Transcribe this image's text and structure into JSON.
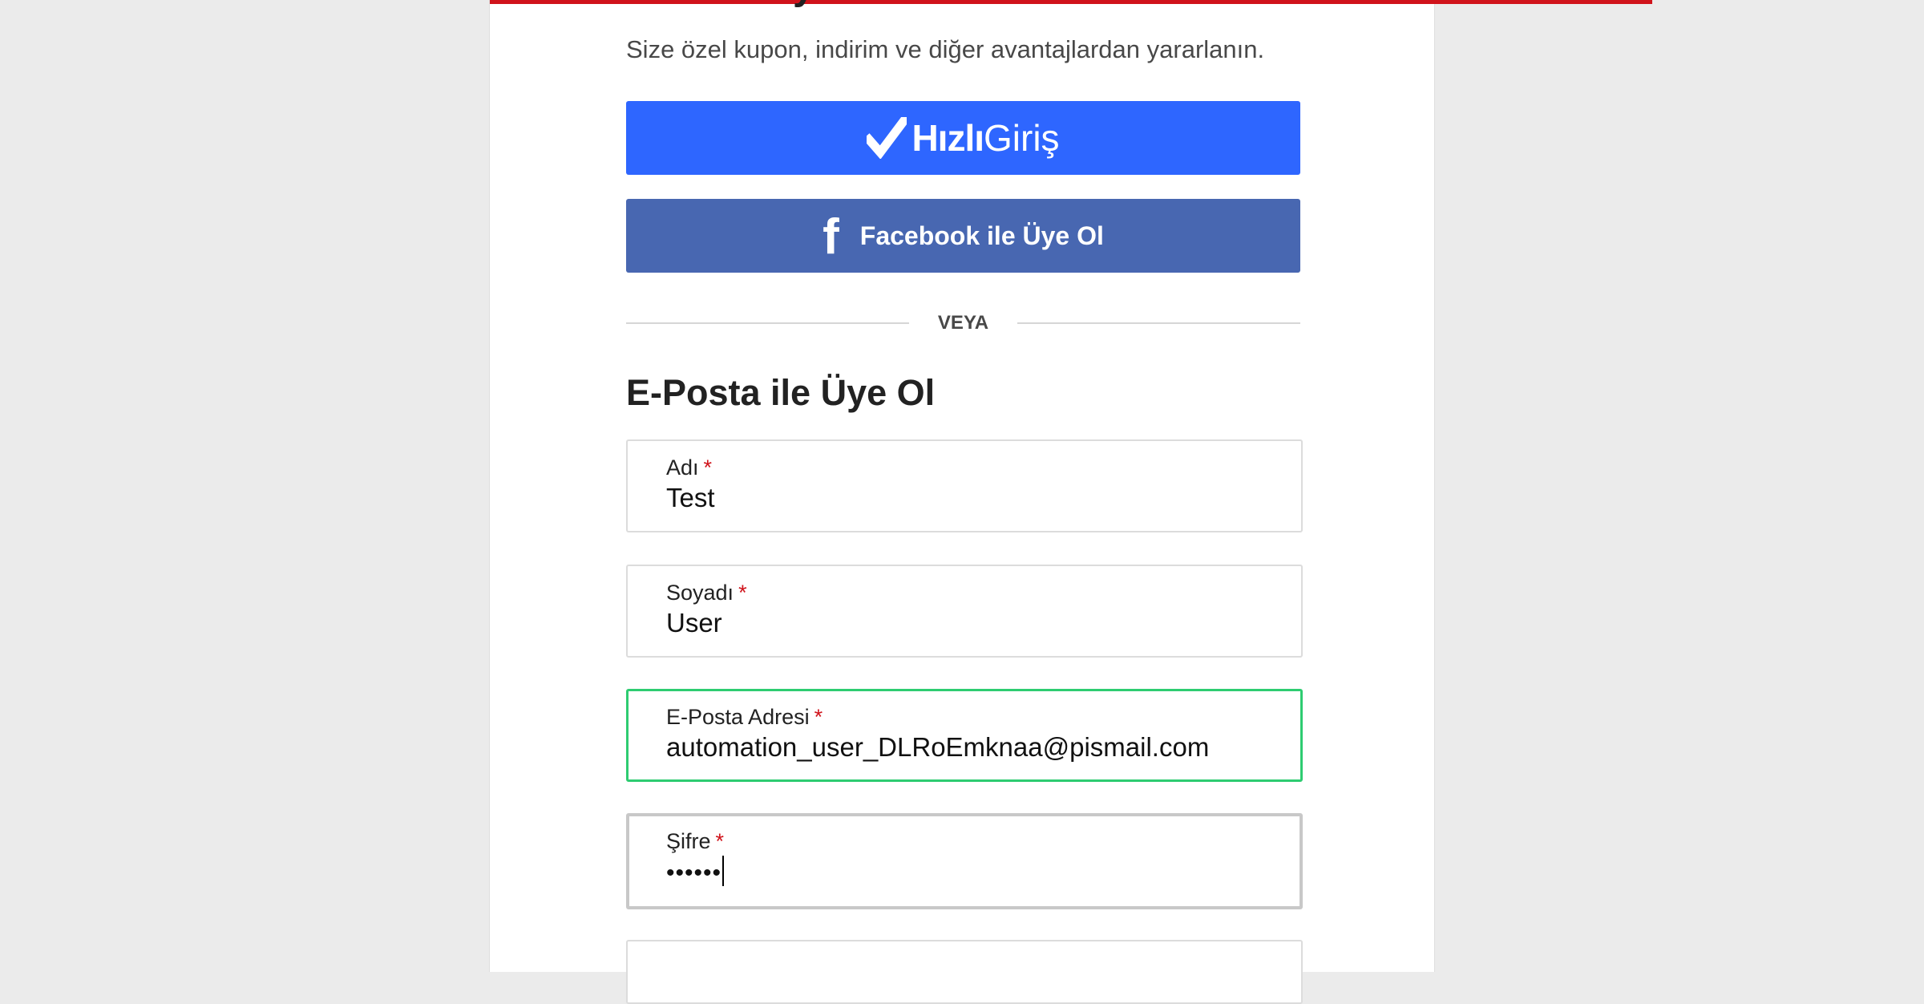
{
  "page": {
    "cut_heading": "Hemen Üye Ol",
    "subtitle": "Size özel kupon, indirim ve diğer avantajlardan yararlanın."
  },
  "colors": {
    "accent_red": "#d0131b",
    "hizli_blue": "#2e66ff",
    "facebook_blue": "#4867b1",
    "focus_green": "#2ecc71"
  },
  "hizli_button": {
    "icon": "check-icon",
    "label_strong": "Hızlı",
    "label_light": "Giriş"
  },
  "facebook_button": {
    "icon": "facebook-icon",
    "label": "Facebook ile Üye Ol"
  },
  "divider": {
    "label": "VEYA"
  },
  "email_signup": {
    "heading": "E-Posta ile Üye Ol",
    "required_marker": "*",
    "fields": [
      {
        "label": "Adı",
        "value": "Test",
        "required": true
      },
      {
        "label": "Soyadı",
        "value": "User",
        "required": true
      },
      {
        "label": "E-Posta Adresi",
        "value": "automation_user_DLRoEmknaa@pismail.com",
        "required": true,
        "state": "valid"
      },
      {
        "label": "Şifre",
        "value": "••••••",
        "required": true,
        "state": "active"
      }
    ]
  }
}
